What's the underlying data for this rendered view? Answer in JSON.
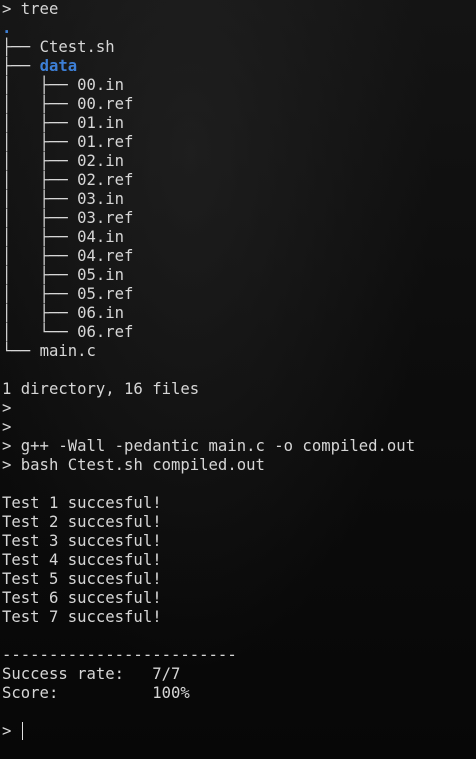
{
  "terminal": {
    "prompt": ">",
    "tree_cmd": "tree",
    "root": ".",
    "tree_l1": [
      {
        "branch": "├── ",
        "name": "Ctest.sh",
        "dir": false
      },
      {
        "branch": "├── ",
        "name": "data",
        "dir": true
      }
    ],
    "tree_data": [
      {
        "branch": "│   ├── ",
        "name": "00.in"
      },
      {
        "branch": "│   ├── ",
        "name": "00.ref"
      },
      {
        "branch": "│   ├── ",
        "name": "01.in"
      },
      {
        "branch": "│   ├── ",
        "name": "01.ref"
      },
      {
        "branch": "│   ├── ",
        "name": "02.in"
      },
      {
        "branch": "│   ├── ",
        "name": "02.ref"
      },
      {
        "branch": "│   ├── ",
        "name": "03.in"
      },
      {
        "branch": "│   ├── ",
        "name": "03.ref"
      },
      {
        "branch": "│   ├── ",
        "name": "04.in"
      },
      {
        "branch": "│   ├── ",
        "name": "04.ref"
      },
      {
        "branch": "│   ├── ",
        "name": "05.in"
      },
      {
        "branch": "│   ├── ",
        "name": "05.ref"
      },
      {
        "branch": "│   ├── ",
        "name": "06.in"
      },
      {
        "branch": "│   └── ",
        "name": "06.ref"
      }
    ],
    "tree_last": {
      "branch": "└── ",
      "name": "main.c"
    },
    "summary": "1 directory, 16 files",
    "compile_cmd": "g++ -Wall -pedantic main.c -o compiled.out",
    "run_cmd": "bash Ctest.sh compiled.out",
    "tests": [
      "Test 1 succesful!",
      "Test 2 succesful!",
      "Test 3 succesful!",
      "Test 4 succesful!",
      "Test 5 succesful!",
      "Test 6 succesful!",
      "Test 7 succesful!"
    ],
    "separator": "-------------------------",
    "success_label": "Success rate:",
    "success_value": "7/7",
    "score_label": "Score:",
    "score_value": "100%",
    "colors": {
      "dir": "#3d7fd6",
      "text": "#d6d6d6",
      "background": "#0b0b0b"
    }
  }
}
